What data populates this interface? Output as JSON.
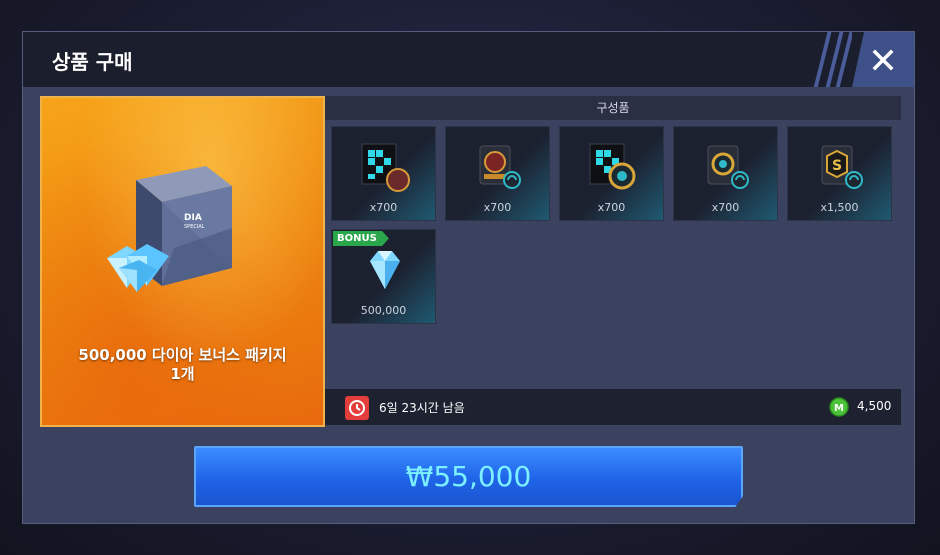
{
  "modal": {
    "title": "상품 구매",
    "close_label": "close"
  },
  "product": {
    "name_line1": "500,000 다이아 보너스 패키지",
    "name_line2": "1개",
    "box_label": "DIA",
    "box_sublabel": "SPECIAL"
  },
  "contents": {
    "header": "구성품",
    "items": [
      {
        "icon": "card-pack-monster-icon",
        "qty": "x700"
      },
      {
        "icon": "monster-ticket-icon",
        "qty": "x700"
      },
      {
        "icon": "card-pack-legend-icon",
        "qty": "x700"
      },
      {
        "icon": "legend-ticket-icon",
        "qty": "x700"
      },
      {
        "icon": "s-grade-ticket-icon",
        "qty": "x1,500"
      }
    ],
    "bonus": {
      "tag": "BONUS",
      "icon": "diamond-icon",
      "qty": "500,000"
    }
  },
  "info": {
    "time_left": "6일 23시간 남음",
    "mileage": "4,500"
  },
  "purchase": {
    "price": "₩55,000"
  },
  "colors": {
    "buy_button": "#1f64e8",
    "price_text": "#7df0ff",
    "panel_orange": "#ee8a10",
    "clock_red": "#e53c3c",
    "bonus_green": "#2aa64b"
  }
}
